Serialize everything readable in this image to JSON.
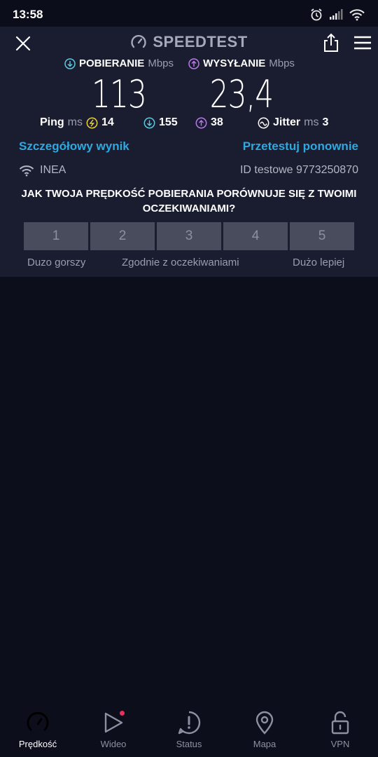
{
  "status_bar": {
    "time": "13:58"
  },
  "header": {
    "title": "SPEEDTEST"
  },
  "download": {
    "label": "POBIERANIE",
    "unit": "Mbps",
    "value": "113"
  },
  "upload": {
    "label": "WYSYŁANIE",
    "unit": "Mbps",
    "value": "23,4"
  },
  "ping": {
    "label": "Ping",
    "unit": "ms",
    "idle": "14",
    "download": "155",
    "upload": "38"
  },
  "jitter": {
    "label": "Jitter",
    "unit": "ms",
    "value": "3"
  },
  "links": {
    "details": "Szczegółowy wynik",
    "retest": "Przetestuj ponownie"
  },
  "connection": {
    "isp": "INEA",
    "test_id": "ID testowe 9773250870"
  },
  "survey": {
    "question": "JAK TWOJA PRĘDKOŚĆ POBIERANIA PORÓWNUJE SIĘ Z TWOIMI OCZEKIWANIAMI?",
    "options": [
      "1",
      "2",
      "3",
      "4",
      "5"
    ],
    "label_low": "Duzo gorszy",
    "label_mid": "Zgodnie z oczekiwaniami",
    "label_high": "Dużo lepiej"
  },
  "nav": [
    {
      "label": "Prędkość",
      "icon": "speedometer-icon",
      "active": true
    },
    {
      "label": "Wideo",
      "icon": "play-icon",
      "badge": true
    },
    {
      "label": "Status",
      "icon": "alert-icon"
    },
    {
      "label": "Mapa",
      "icon": "map-pin-icon"
    },
    {
      "label": "VPN",
      "icon": "lock-open-icon"
    }
  ],
  "colors": {
    "background": "#0c0e1c",
    "panel": "#1a1d30",
    "accent_link": "#2fa8e0",
    "download": "#5dc8e0",
    "upload": "#b77ae8",
    "ping_idle": "#e8d23a",
    "badge": "#e8305a",
    "progress": "#3bc43b"
  }
}
